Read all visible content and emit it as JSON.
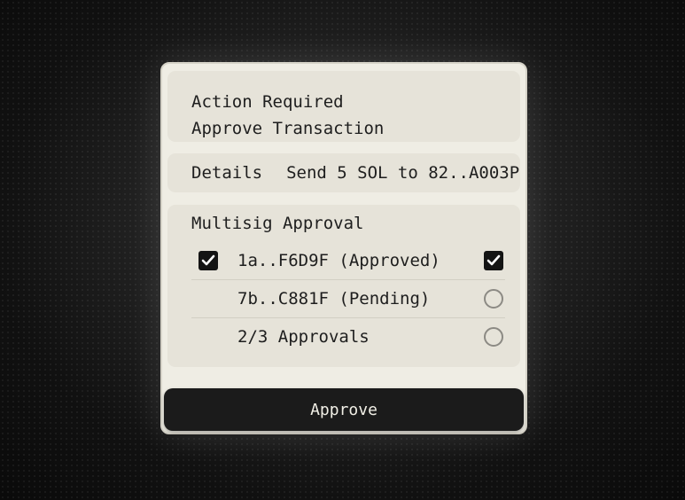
{
  "header": {
    "line1": "Action Required",
    "line2": "Approve Transaction"
  },
  "details": {
    "label": "Details",
    "value": "Send 5 SOL to 82..A003P"
  },
  "multisig": {
    "title": "Multisig Approval",
    "rows": [
      {
        "label": "1a..F6D9F (Approved)",
        "left_checked": true,
        "right_state": "checked"
      },
      {
        "label": "7b..C881F (Pending)",
        "left_checked": false,
        "right_state": "unchecked"
      },
      {
        "label": "2/3 Approvals",
        "left_checked": false,
        "right_state": "unchecked"
      }
    ]
  },
  "actions": {
    "approve_label": "Approve"
  },
  "colors": {
    "card_bg": "#efede4",
    "section_bg": "#e6e3d9",
    "button_bg": "#1b1b1b",
    "button_text": "#f1efe6",
    "text": "#1e1e1e"
  }
}
